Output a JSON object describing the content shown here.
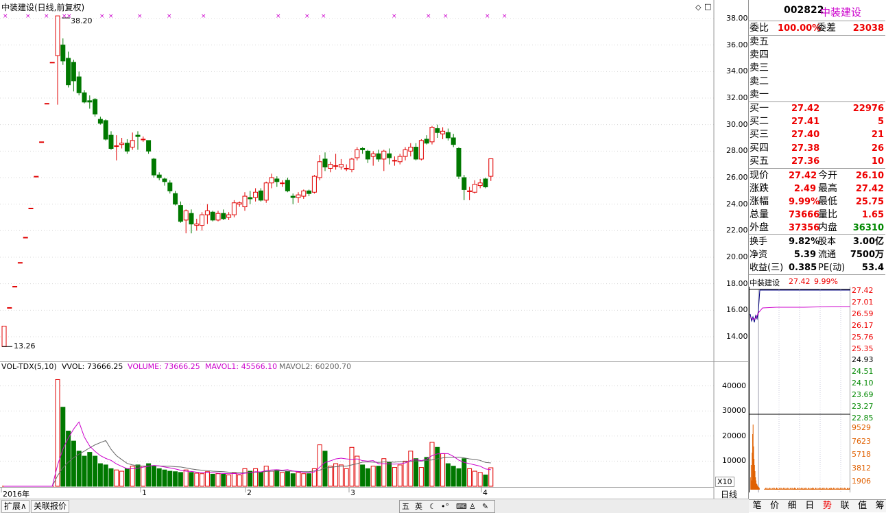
{
  "main_title": "中装建设(日线,前复权)",
  "price_axis": [
    "38.00",
    "36.00",
    "34.00",
    "32.00",
    "30.00",
    "28.00",
    "26.00",
    "24.00",
    "22.00",
    "20.00",
    "18.00",
    "16.00",
    "14.00"
  ],
  "price_high_label": "38.20",
  "price_low_label": "13.26",
  "volume_header": {
    "indicator": "VOL-TDX(5,10)",
    "vvol": "VVOL: 73666.25",
    "volume": "VOLUME: 73666.25",
    "mavol1": "MAVOL1: 45566.10",
    "mavol2": "MAVOL2: 60200.70"
  },
  "volume_axis": [
    "40000",
    "30000",
    "20000",
    "10000"
  ],
  "volume_unit": "X10",
  "date_axis": [
    "2016年",
    "1",
    "2",
    "3",
    "4"
  ],
  "period_label": "日线",
  "stock": {
    "code": "002822",
    "name": "中装建设"
  },
  "quote": {
    "weibi_label": "委比",
    "weibi": "100.00%",
    "weicha_label": "委差",
    "weicha": "23038",
    "sell": [
      {
        "label": "卖五",
        "price": "",
        "vol": ""
      },
      {
        "label": "卖四",
        "price": "",
        "vol": ""
      },
      {
        "label": "卖三",
        "price": "",
        "vol": ""
      },
      {
        "label": "卖二",
        "price": "",
        "vol": ""
      },
      {
        "label": "卖一",
        "price": "",
        "vol": ""
      }
    ],
    "buy": [
      {
        "label": "买一",
        "price": "27.42",
        "vol": "22976"
      },
      {
        "label": "买二",
        "price": "27.41",
        "vol": "5"
      },
      {
        "label": "买三",
        "price": "27.40",
        "vol": "21"
      },
      {
        "label": "买四",
        "price": "27.38",
        "vol": "26"
      },
      {
        "label": "买五",
        "price": "27.36",
        "vol": "10"
      }
    ],
    "stats": [
      {
        "l1": "现价",
        "v1": "27.42",
        "c1": "red",
        "l2": "今开",
        "v2": "26.10",
        "c2": "red"
      },
      {
        "l1": "涨跌",
        "v1": "2.49",
        "c1": "red",
        "l2": "最高",
        "v2": "27.42",
        "c2": "red"
      },
      {
        "l1": "涨幅",
        "v1": "9.99%",
        "c1": "red",
        "l2": "最低",
        "v2": "25.75",
        "c2": "red"
      },
      {
        "l1": "总量",
        "v1": "73666",
        "c1": "red",
        "l2": "量比",
        "v2": "1.65",
        "c2": "red"
      },
      {
        "l1": "外盘",
        "v1": "37356",
        "c1": "red",
        "l2": "内盘",
        "v2": "36310",
        "c2": "grn"
      }
    ],
    "stats2": [
      {
        "l1": "换手",
        "v1": "9.82%",
        "l2": "股本",
        "v2": "3.00亿"
      },
      {
        "l1": "净资",
        "v1": "5.39",
        "l2": "流通",
        "v2": "7500万"
      },
      {
        "l1": "收益(三)",
        "v1": "0.385",
        "l2": "PE(动)",
        "v2": "53.4"
      }
    ]
  },
  "mini": {
    "name": "中装建设",
    "price": "27.42",
    "pct": "9.99%",
    "price_labels": [
      "27.42",
      "27.01",
      "26.59",
      "26.17",
      "25.76",
      "25.35",
      "24.93",
      "24.51",
      "24.10",
      "23.69",
      "23.27",
      "22.85"
    ],
    "vol_labels": [
      "9529",
      "7623",
      "5718",
      "3812",
      "1906"
    ]
  },
  "bottom_tabs": [
    "笔",
    "价",
    "细",
    "日",
    "势",
    "联",
    "值",
    "筹"
  ],
  "active_tab": "势",
  "status_buttons": [
    "扩展∧",
    "关联报价"
  ],
  "ime": [
    "五",
    "英"
  ],
  "colors": {
    "up": "#e00000",
    "down": "#007800",
    "ma1": "#cc00cc",
    "ma2": "#666666",
    "grid": "#d8d8d8"
  },
  "chart_data": {
    "type": "candlestick",
    "title": "中装建设(日线,前复权)",
    "ylim": [
      13,
      39
    ],
    "high_mark": 38.2,
    "low_mark": 13.26,
    "ohlc": [
      [
        13.26,
        14.8,
        13.26,
        14.8
      ],
      [
        16.2,
        16.2,
        16.2,
        16.2
      ],
      [
        17.8,
        17.8,
        17.8,
        17.8
      ],
      [
        19.6,
        19.6,
        19.6,
        19.6
      ],
      [
        21.5,
        21.5,
        21.5,
        21.5
      ],
      [
        23.7,
        23.7,
        23.7,
        23.7
      ],
      [
        26.1,
        26.1,
        26.1,
        26.1
      ],
      [
        28.7,
        28.7,
        28.7,
        28.7
      ],
      [
        31.6,
        31.6,
        31.6,
        31.6
      ],
      [
        34.7,
        34.7,
        34.7,
        34.7
      ],
      [
        35.2,
        38.2,
        31.5,
        38.2
      ],
      [
        36.0,
        36.5,
        34.5,
        34.8
      ],
      [
        35.0,
        35.5,
        32.8,
        33.0
      ],
      [
        34.7,
        34.9,
        32.5,
        33.3
      ],
      [
        33.6,
        34.0,
        32.2,
        32.4
      ],
      [
        32.4,
        32.6,
        31.6,
        31.7
      ],
      [
        31.8,
        32.2,
        31.2,
        31.7
      ],
      [
        31.9,
        32.0,
        30.6,
        30.8
      ],
      [
        30.4,
        30.6,
        30.0,
        30.1
      ],
      [
        30.3,
        30.4,
        28.8,
        28.9
      ],
      [
        29.2,
        29.5,
        28.1,
        28.2
      ],
      [
        28.4,
        29.2,
        27.3,
        28.4
      ],
      [
        28.5,
        29.0,
        28.2,
        28.6
      ],
      [
        28.6,
        28.9,
        27.8,
        28.0
      ],
      [
        28.3,
        29.4,
        28.1,
        28.8
      ],
      [
        29.2,
        29.5,
        28.1,
        29.1
      ],
      [
        28.9,
        29.1,
        28.7,
        28.9
      ],
      [
        28.8,
        28.8,
        27.8,
        28.0
      ],
      [
        27.4,
        27.5,
        26.0,
        26.2
      ],
      [
        26.2,
        26.4,
        25.8,
        26.0
      ],
      [
        25.9,
        26.0,
        25.4,
        25.7
      ],
      [
        25.6,
        25.8,
        24.8,
        25.0
      ],
      [
        24.8,
        25.0,
        23.9,
        24.0
      ],
      [
        23.9,
        24.2,
        22.6,
        22.7
      ],
      [
        22.8,
        23.6,
        21.8,
        23.5
      ],
      [
        23.3,
        23.6,
        21.8,
        22.5
      ],
      [
        22.4,
        22.9,
        22.0,
        22.5
      ],
      [
        22.4,
        23.4,
        22.0,
        23.2
      ],
      [
        23.2,
        24.0,
        22.5,
        23.5
      ],
      [
        23.4,
        23.5,
        22.7,
        22.8
      ],
      [
        22.8,
        23.5,
        22.7,
        23.3
      ],
      [
        23.3,
        23.6,
        22.8,
        22.9
      ],
      [
        23.0,
        23.4,
        22.8,
        23.2
      ],
      [
        23.2,
        24.3,
        23.0,
        24.1
      ],
      [
        24.0,
        24.2,
        23.8,
        24.1
      ],
      [
        23.8,
        24.9,
        23.5,
        24.6
      ],
      [
        24.5,
        25.0,
        24.0,
        24.4
      ],
      [
        24.5,
        25.2,
        24.2,
        24.9
      ],
      [
        25.0,
        25.2,
        24.2,
        24.3
      ],
      [
        24.3,
        25.7,
        24.1,
        25.6
      ],
      [
        25.6,
        26.3,
        25.2,
        26.0
      ],
      [
        25.9,
        26.1,
        25.3,
        25.7
      ],
      [
        25.6,
        25.8,
        25.3,
        25.6
      ],
      [
        25.8,
        26.0,
        24.9,
        25.0
      ],
      [
        24.6,
        24.8,
        24.0,
        24.5
      ],
      [
        24.5,
        24.9,
        24.1,
        24.7
      ],
      [
        24.6,
        25.1,
        24.4,
        25.0
      ],
      [
        25.0,
        25.1,
        24.6,
        24.8
      ],
      [
        24.9,
        26.2,
        24.8,
        26.1
      ],
      [
        26.0,
        27.7,
        25.8,
        27.2
      ],
      [
        27.4,
        27.9,
        26.5,
        26.8
      ],
      [
        26.7,
        27.2,
        26.4,
        27.0
      ],
      [
        26.9,
        27.8,
        26.6,
        26.9
      ],
      [
        26.8,
        27.4,
        26.6,
        27.0
      ],
      [
        26.7,
        27.0,
        26.5,
        26.7
      ],
      [
        26.6,
        27.5,
        26.4,
        27.4
      ],
      [
        27.5,
        28.3,
        27.3,
        28.1
      ],
      [
        28.2,
        28.3,
        27.8,
        28.1
      ],
      [
        28.0,
        28.1,
        27.1,
        27.4
      ],
      [
        27.6,
        28.0,
        26.9,
        27.8
      ],
      [
        27.8,
        28.1,
        27.2,
        27.4
      ],
      [
        27.4,
        28.1,
        26.5,
        28.0
      ],
      [
        27.8,
        28.2,
        27.0,
        27.5
      ],
      [
        27.3,
        27.6,
        26.9,
        27.3
      ],
      [
        27.2,
        27.8,
        27.0,
        27.6
      ],
      [
        27.6,
        28.3,
        27.3,
        28.1
      ],
      [
        28.0,
        28.6,
        27.6,
        28.3
      ],
      [
        28.3,
        28.6,
        27.3,
        27.4
      ],
      [
        27.4,
        28.9,
        27.3,
        28.8
      ],
      [
        28.9,
        29.2,
        28.5,
        28.6
      ],
      [
        28.7,
        29.9,
        28.5,
        29.8
      ],
      [
        29.7,
        30.0,
        29.0,
        29.4
      ],
      [
        29.3,
        29.8,
        28.9,
        29.5
      ],
      [
        29.4,
        29.7,
        28.8,
        29.0
      ],
      [
        29.0,
        29.3,
        28.3,
        28.5
      ],
      [
        28.2,
        28.3,
        25.9,
        26.1
      ],
      [
        26.0,
        26.2,
        24.3,
        25.1
      ],
      [
        25.0,
        25.3,
        24.3,
        25.0
      ],
      [
        24.9,
        25.8,
        24.8,
        25.5
      ],
      [
        25.4,
        25.9,
        25.2,
        25.6
      ],
      [
        25.9,
        26.0,
        25.2,
        25.3
      ],
      [
        26.1,
        27.42,
        25.75,
        27.42
      ]
    ],
    "volume_x10": [
      0,
      0,
      0,
      0,
      0,
      0,
      0,
      0,
      0,
      0,
      42500,
      31500,
      22000,
      18000,
      14000,
      12000,
      13500,
      12000,
      9000,
      8500,
      7000,
      6500,
      6000,
      7000,
      8000,
      8500,
      8000,
      9000,
      8000,
      7000,
      6500,
      6000,
      5800,
      5500,
      6500,
      5500,
      5200,
      5000,
      5800,
      4800,
      5000,
      4800,
      4500,
      5200,
      4500,
      7000,
      6000,
      7000,
      5500,
      8000,
      6000,
      6500,
      5500,
      6000,
      5000,
      5500,
      5000,
      5000,
      7000,
      16500,
      14000,
      8000,
      9000,
      8500,
      7000,
      15500,
      12000,
      8500,
      7000,
      8000,
      8000,
      11000,
      9500,
      7500,
      8500,
      10000,
      14000,
      11000,
      7500,
      11500,
      17500,
      15500,
      13000,
      9000,
      8000,
      7000,
      11000,
      7000,
      6000,
      5500,
      4500,
      7366
    ],
    "mavol1_x10": [
      0,
      0,
      0,
      0,
      0,
      0,
      0,
      0,
      0,
      0,
      8500,
      14800,
      19200,
      22800,
      25600,
      19600,
      16000,
      13900,
      12200,
      11100,
      10300,
      8900,
      7900,
      7000,
      7000,
      7200,
      7600,
      8000,
      8300,
      8100,
      7700,
      7300,
      6900,
      6400,
      6000,
      5900,
      5600,
      5400,
      5600,
      5400,
      5200,
      5100,
      5000,
      5100,
      4900,
      5200,
      5400,
      5800,
      5700,
      6300,
      6500,
      6600,
      6400,
      6600,
      6100,
      5800,
      5600,
      5400,
      5700,
      7600,
      9500,
      10100,
      10900,
      11200,
      10900,
      10700,
      10900,
      10200,
      10000,
      10200,
      9000,
      9000,
      8900,
      8800,
      9000,
      9300,
      10300,
      10600,
      10200,
      10800,
      12200,
      12900,
      13000,
      13000,
      11900,
      10400,
      9500,
      9000,
      8500,
      8000,
      6900,
      6600
    ],
    "mavol2_x10": [
      0,
      0,
      0,
      0,
      0,
      0,
      0,
      0,
      0,
      0,
      4250,
      7400,
      9600,
      11400,
      12800,
      14000,
      15300,
      16500,
      17400,
      18200,
      14700,
      12200,
      10600,
      9100,
      8500,
      8200,
      8000,
      8100,
      8200,
      8100,
      8000,
      8000,
      7800,
      7700,
      7300,
      6900,
      6600,
      6400,
      6200,
      6000,
      5900,
      5800,
      5600,
      5500,
      5400,
      5400,
      5500,
      5600,
      5600,
      5900,
      6000,
      6100,
      6100,
      6000,
      6000,
      5900,
      5800,
      5800,
      6100,
      6400,
      7300,
      7500,
      7800,
      8000,
      8000,
      8500,
      9000,
      9600,
      9700,
      9600,
      9500,
      9700,
      9700,
      9600,
      9800,
      9800,
      9900,
      10100,
      10000,
      10300,
      10500,
      10900,
      11300,
      11500,
      11500,
      11600,
      11300,
      10900,
      10700,
      10300,
      9500,
      9300
    ]
  }
}
